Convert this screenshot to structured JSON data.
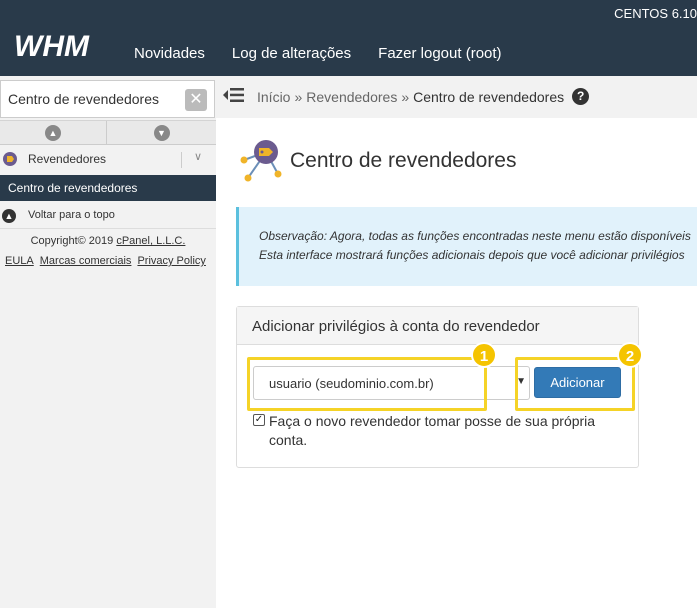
{
  "header": {
    "os_version": "CENTOS 6.10",
    "logo_text": "WHM",
    "nav": [
      "Novidades",
      "Log de alterações",
      "Fazer logout (root)"
    ]
  },
  "sidebar": {
    "search_value": "Centro de revendedores",
    "section_label": "Revendedores",
    "active_item": "Centro de revendedores",
    "back_to_top": "Voltar para o topo",
    "copyright_prefix": "Copyright© 2019 ",
    "copyright_link": "cPanel, L.L.C.",
    "legal_links": [
      "EULA",
      "Marcas comerciais",
      "Privacy Policy"
    ]
  },
  "breadcrumb": {
    "items": [
      "Início",
      "Revendedores",
      "Centro de revendedores"
    ],
    "separator": "»"
  },
  "main": {
    "title": "Centro de revendedores",
    "notice_line1": "Observação: Agora, todas as funções encontradas neste menu estão disponíveis",
    "notice_line2": "Esta interface mostrará funções adicionais depois que você adicionar privilégios",
    "panel": {
      "title": "Adicionar privilégios à conta do revendedor",
      "account_value": "usuario (seudominio.com.br)",
      "add_label": "Adicionar",
      "owner_checked": true,
      "owner_label": "Faça o novo revendedor tomar posse de sua própria conta."
    },
    "callouts": [
      "1",
      "2"
    ]
  },
  "colors": {
    "header_bg": "#293a4a",
    "primary_button": "#337ab7",
    "callout": "#f5d327",
    "notice_bg": "#e1f2fb"
  }
}
